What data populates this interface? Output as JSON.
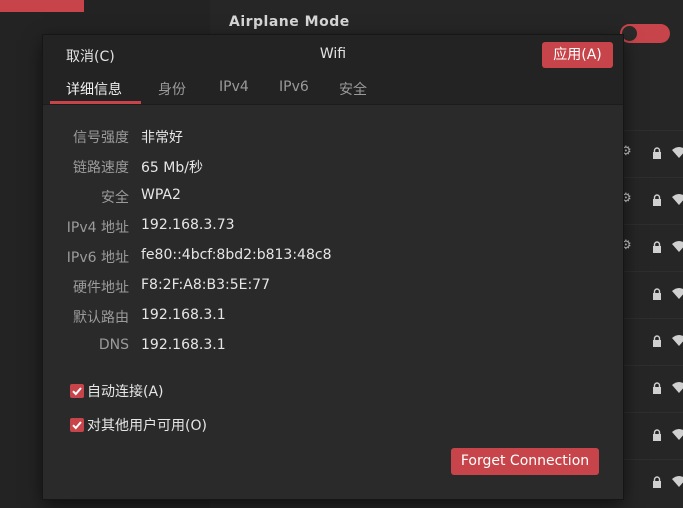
{
  "background": {
    "airplane_mode_label": "Airplane Mode",
    "network_rows": [
      {
        "has_gear": true
      },
      {
        "has_gear": true
      },
      {
        "has_gear": true
      },
      {
        "has_gear": false
      },
      {
        "has_gear": false
      },
      {
        "has_gear": false
      },
      {
        "has_gear": false
      },
      {
        "has_gear": false
      }
    ]
  },
  "dialog": {
    "title": "Wifi",
    "cancel_label": "取消(C)",
    "apply_label": "应用(A)",
    "tabs": [
      {
        "label": "详细信息",
        "active": true
      },
      {
        "label": "身份",
        "active": false
      },
      {
        "label": "IPv4",
        "active": false
      },
      {
        "label": "IPv6",
        "active": false
      },
      {
        "label": "安全",
        "active": false
      }
    ],
    "details": [
      {
        "label": "信号强度",
        "value": "非常好"
      },
      {
        "label": "链路速度",
        "value": "65 Mb/秒"
      },
      {
        "label": "安全",
        "value": "WPA2"
      },
      {
        "label": "IPv4 地址",
        "value": "192.168.3.73"
      },
      {
        "label": "IPv6 地址",
        "value": "fe80::4bcf:8bd2:b813:48c8"
      },
      {
        "label": "硬件地址",
        "value": "F8:2F:A8:B3:5E:77"
      },
      {
        "label": "默认路由",
        "value": "192.168.3.1"
      },
      {
        "label": "DNS",
        "value": "192.168.3.1"
      }
    ],
    "auto_connect": {
      "label": "自动连接(A)",
      "checked": true
    },
    "available_to_others": {
      "label": "对其他用户可用(O)",
      "checked": true
    },
    "forget_label": "Forget Connection"
  },
  "colors": {
    "accent": "#c7454a",
    "dialog_bg": "#2a2a2a",
    "header_bg": "#232323"
  },
  "icons": [
    "gear-icon",
    "lock-icon",
    "wifi-icon",
    "checkmark-icon"
  ]
}
